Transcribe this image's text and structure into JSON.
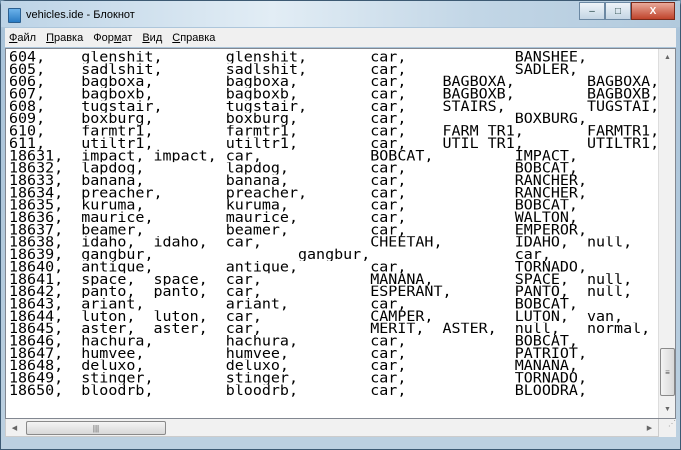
{
  "window": {
    "title": "vehicles.ide - Блокнот",
    "minimize": "–",
    "maximize": "□",
    "close": "X"
  },
  "menu": [
    {
      "accel": "Ф",
      "rest": "айл"
    },
    {
      "accel": "П",
      "rest": "равка"
    },
    {
      "pre": "Фор",
      "accel": "м",
      "rest": "ат"
    },
    {
      "accel": "В",
      "rest": "ид"
    },
    {
      "accel": "С",
      "rest": "правка"
    }
  ],
  "lines": [
    "604,\tglenshit,\tglenshit,\tcar,\t\tBANSHEE,",
    "605,\tsadlshit,\tsadlshit,\tcar,\t\tSADLER,",
    "606,\tbagboxa,\tbagboxa,\tcar,\tBAGBOXA,\tBAGBOXA,",
    "607,\tbagboxb,\tbagboxb,\tcar,\tBAGBOXB,\tBAGBOXB,",
    "608,\ttugstair,\ttugstair,\tcar,\tSTAIRS,\t\tTUGSTAI,",
    "609,\tboxburg,\tboxburg,\tcar,\t\tBOXBURG,",
    "610,\tfarmtr1,\tfarmtr1,\tcar,\tFARM_TR1,\tFARMTR1,",
    "611,\tutiltr1,\tutiltr1,\tcar,\tUTIL_TR1,\tUTILTR1,",
    "18631,\timpact,\timpact,\tcar,\t\tBOBCAT,\t\tIMPACT,",
    "18632,\tlapdog,\t\tlapdog,\t\tcar,\t\tBOBCAT,",
    "18633,\tbanana,\t\tbanana,\t\tcar,\t\tRANCHER,",
    "18634,\tpreacher,\tpreacher,\tcar,\t\tRANCHER,",
    "18635,\tkuruma,\t\tkuruma,\t\tcar,\t\tBOBCAT,",
    "18636,\tmaurice,\tmaurice,\tcar,\t\tWALTON,",
    "18637,\tbeamer,\t\tbeamer,\t\tcar,\t\tEMPEROR,",
    "18638,\tidaho,\tidaho,\tcar,\t\tCHEETAH,\tIDAHO,\tnull,",
    "18639,\tgangbur,\t\tgangbur,\t\tcar,",
    "18640,\tantique,\tantique,\tcar,\t\tTORNADO,",
    "18641,\tspace,\tspace,\tcar,\t\tMANANA,\t\tSPACE,\tnull,",
    "18642,\tpanto,\tpanto,\tcar,\t\tESPERANT,\tPANTO,\tnull,",
    "18643,\tariant,\t\tariant,\t\tcar,\t\tBOBCAT,",
    "18644,\tluton,\tluton,\tcar,\t\tCAMPER,\t\tLUTON,\tvan,",
    "18645,\taster,\taster,\tcar,\t\tMERIT,\tASTER,\tnull,\tnormal,",
    "18646,\thachura,\thachura,\tcar,\t\tBOBCAT,",
    "18647,\thumvee,\t\thumvee,\t\tcar,\t\tPATRIOT,",
    "18648,\tdeluxo,\t\tdeluxo,\t\tcar,\t\tMANANA,",
    "18649,\tstinger,\tstinger,\tcar,\t\tTORNADO,",
    "18650,\tbloodrb,\tbloodrb,\tcar,\t\tBLOODRA,"
  ]
}
